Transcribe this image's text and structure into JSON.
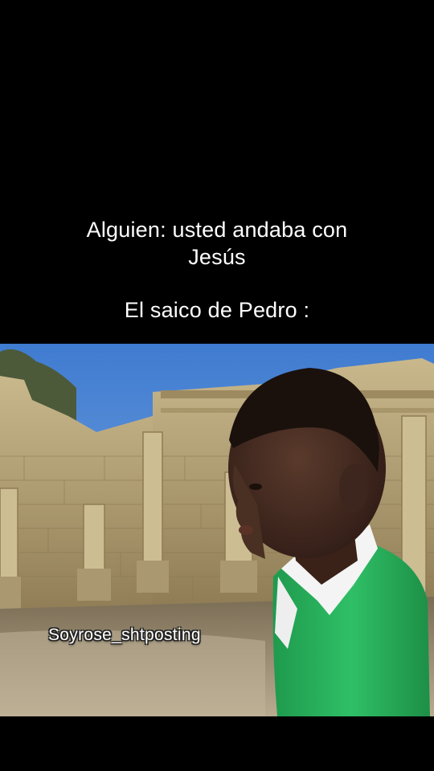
{
  "captions": {
    "line1": "Alguien: usted andaba con",
    "line2": "Jesús",
    "line3": "El saico de Pedro :"
  },
  "watermark": {
    "text": "Soyrose_shtposting"
  },
  "colors": {
    "background": "#000000",
    "caption_text": "#ffffff",
    "sky": "#4f87d6",
    "stone": "#b9a57a",
    "shirt": "#27b15b",
    "collar": "#f4f4f4",
    "skin": "#3b241c"
  },
  "photo": {
    "description_icon": "ruins-and-boy-photo"
  }
}
